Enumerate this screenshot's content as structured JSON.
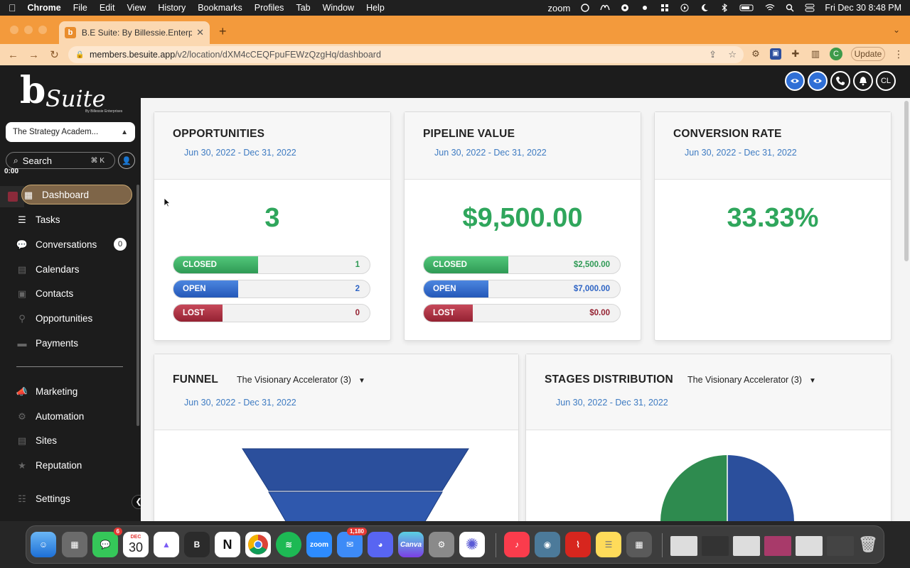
{
  "menubar": {
    "apple": "",
    "items": [
      "Chrome",
      "File",
      "Edit",
      "View",
      "History",
      "Bookmarks",
      "Profiles",
      "Tab",
      "Window",
      "Help"
    ],
    "zoom_label": "zoom",
    "datetime": "Fri Dec 30  8:48 PM"
  },
  "browser": {
    "tab_title": "B.E Suite: By Billessie.Enterprises",
    "tab_favicon": "b",
    "url_host": "members.besuite.app",
    "url_path": "/v2/location/dXM4cCEQFpuFEWzQzgHq/dashboard",
    "profile_initial": "C",
    "update_label": "Update"
  },
  "sidebar": {
    "logo_b": "b",
    "logo_text": "Suite",
    "logo_sub": "By Billessie Enterprises",
    "account": "The Strategy Academ...",
    "search_label": "Search",
    "search_shortcut": "⌘ K",
    "timer": "0:00",
    "items": [
      {
        "label": "Dashboard",
        "icon": "dashboard-icon",
        "active": true
      },
      {
        "label": "Tasks",
        "icon": "tasks-icon"
      },
      {
        "label": "Conversations",
        "icon": "chat-icon",
        "badge": "0"
      },
      {
        "label": "Calendars",
        "icon": "calendar-icon"
      },
      {
        "label": "Contacts",
        "icon": "contacts-icon"
      },
      {
        "label": "Opportunities",
        "icon": "funnel-icon"
      },
      {
        "label": "Payments",
        "icon": "payments-icon"
      },
      {
        "label": "Marketing",
        "icon": "megaphone-icon"
      },
      {
        "label": "Automation",
        "icon": "gear-icon"
      },
      {
        "label": "Sites",
        "icon": "globe-icon"
      },
      {
        "label": "Reputation",
        "icon": "star-icon"
      },
      {
        "label": "Settings",
        "icon": "settings-icon"
      }
    ]
  },
  "header": {
    "user_initials": "CL"
  },
  "cards": {
    "opportunities": {
      "title": "OPPORTUNITIES",
      "range": "Jun 30, 2022 - Dec 31, 2022",
      "total": "3",
      "rows": [
        {
          "label": "CLOSED",
          "value": "1",
          "share": 0.43
        },
        {
          "label": "OPEN",
          "value": "2",
          "share": 0.33
        },
        {
          "label": "LOST",
          "value": "0",
          "share": 0.25
        }
      ]
    },
    "pipeline": {
      "title": "PIPELINE VALUE",
      "range": "Jun 30, 2022 - Dec 31, 2022",
      "total": "$9,500.00",
      "rows": [
        {
          "label": "CLOSED",
          "value": "$2,500.00",
          "share": 0.43
        },
        {
          "label": "OPEN",
          "value": "$7,000.00",
          "share": 0.33
        },
        {
          "label": "LOST",
          "value": "$0.00",
          "share": 0.25
        }
      ]
    },
    "conversion": {
      "title": "CONVERSION RATE",
      "range": "Jun 30, 2022 - Dec 31, 2022",
      "total": "33.33%"
    },
    "funnel": {
      "title": "FUNNEL",
      "pipeline_select": "The Visionary Accelerator (3)",
      "range": "Jun 30, 2022 - Dec 31, 2022"
    },
    "stages": {
      "title": "STAGES DISTRIBUTION",
      "pipeline_select": "The Visionary Accelerator (3)",
      "range": "Jun 30, 2022 - Dec 31, 2022"
    }
  },
  "colors": {
    "accent_green": "#2fa65c",
    "link_blue": "#3e7bc2",
    "funnel_blue": "#2b4f9c",
    "pie_green": "#2e8b4f"
  },
  "dock": {
    "messages_badge": "6",
    "calendar_month": "DEC",
    "calendar_day": "30",
    "mail_badge": "1,180",
    "zoom_label": "zoom",
    "canva_label": "Canva",
    "b_label": "B",
    "notion_label": "N"
  }
}
